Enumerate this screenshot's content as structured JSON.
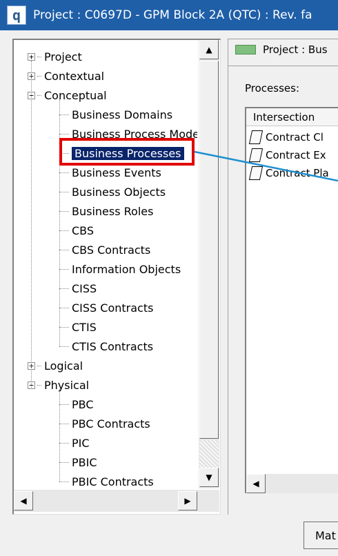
{
  "window": {
    "title": "Project : C0697D - GPM Block 2A (QTC) : Rev. fa",
    "app_icon_glyph": "q"
  },
  "tree": {
    "items": [
      {
        "label": "Project",
        "level": 0,
        "expander": "+"
      },
      {
        "label": "Contextual",
        "level": 0,
        "expander": "+"
      },
      {
        "label": "Conceptual",
        "level": 0,
        "expander": "−"
      },
      {
        "label": "Business Domains",
        "level": 1
      },
      {
        "label": "Business Process Model",
        "level": 1
      },
      {
        "label": "Business Processes",
        "level": 1,
        "selected": true
      },
      {
        "label": "Business Events",
        "level": 1
      },
      {
        "label": "Business Objects",
        "level": 1
      },
      {
        "label": "Business Roles",
        "level": 1
      },
      {
        "label": "CBS",
        "level": 1
      },
      {
        "label": "CBS Contracts",
        "level": 1
      },
      {
        "label": "Information Objects",
        "level": 1
      },
      {
        "label": "CISS",
        "level": 1
      },
      {
        "label": "CISS Contracts",
        "level": 1
      },
      {
        "label": "CTIS",
        "level": 1
      },
      {
        "label": "CTIS Contracts",
        "level": 1
      },
      {
        "label": "Logical",
        "level": 0,
        "expander": "+"
      },
      {
        "label": "Physical",
        "level": 0,
        "expander": "−"
      },
      {
        "label": "PBC",
        "level": 1
      },
      {
        "label": "PBC Contracts",
        "level": 1
      },
      {
        "label": "PIC",
        "level": 1
      },
      {
        "label": "PBIC",
        "level": 1
      },
      {
        "label": "PBIC Contracts",
        "level": 1
      }
    ],
    "selection_color": "#0a246a",
    "highlight_color": "#e10000"
  },
  "right_panel": {
    "header_text": "Project : Bus",
    "header_swatch_color": "#7fc07f",
    "processes_label": "Processes:",
    "list_column_header": "Intersection",
    "rows": [
      {
        "label": "Contract Cl"
      },
      {
        "label": "Contract Ex"
      },
      {
        "label": "Contract Pla"
      }
    ]
  },
  "bottom_button": {
    "label": "Mat"
  },
  "connector_color": "#1e8fd0"
}
